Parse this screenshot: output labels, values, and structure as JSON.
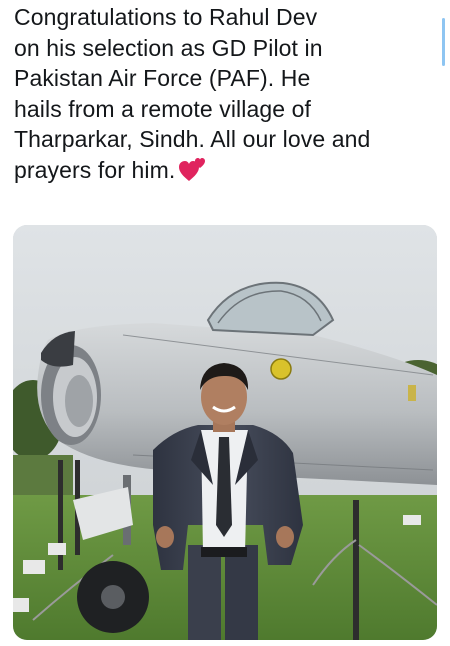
{
  "post": {
    "text_lines": [
      "Congratulations to Rahul Dev",
      "on his selection as GD Pilot in",
      "Pakistan Air Force (PAF). He",
      "hails from a remote village of",
      "Tharparkar, Sindh. All our love and",
      "prayers for him."
    ],
    "emoji_icon": "two-hearts-icon",
    "media": {
      "type": "photo"
    }
  },
  "colors": {
    "text": "#14171a",
    "heart": "#e0245e",
    "scroll_indicator": "#8ec5f2"
  }
}
